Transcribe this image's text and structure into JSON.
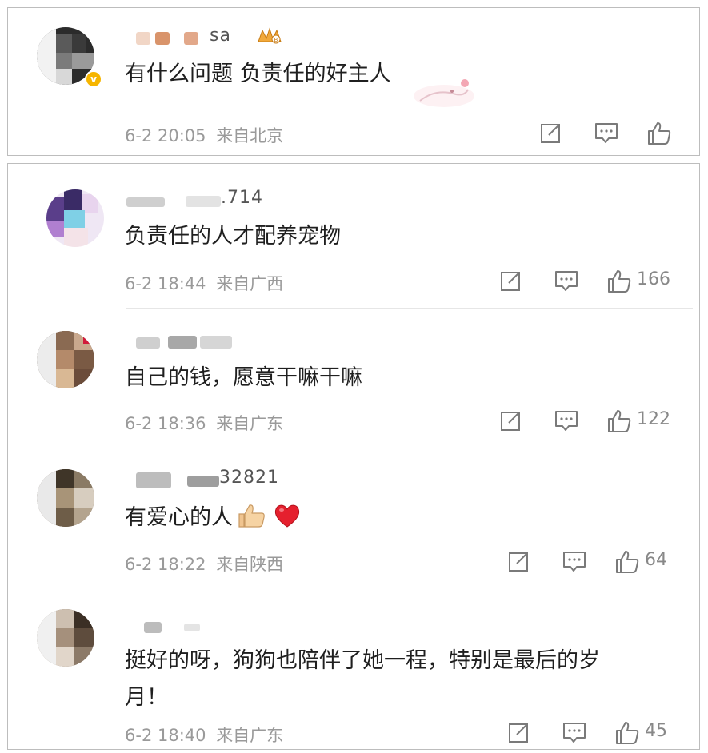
{
  "comments": [
    {
      "username": "sa",
      "verified": true,
      "text": "有什么问题 负责任的好主人",
      "time": "6-2 20:05",
      "location": "来自北京",
      "likes": ""
    },
    {
      "username": ".714",
      "text": "负责任的人才配养宠物",
      "time": "6-2 18:44",
      "location": "来自广西",
      "likes": "166"
    },
    {
      "username": "",
      "text": "自己的钱，愿意干嘛干嘛",
      "time": "6-2 18:36",
      "location": "来自广东",
      "likes": "122"
    },
    {
      "username": "32821",
      "text": "有爱心的人",
      "time": "6-2 18:22",
      "location": "来自陕西",
      "likes": "64"
    },
    {
      "username": "",
      "text_line1": "挺好的呀，狗狗也陪伴了她一程，特别是最后的岁",
      "text_line2": "月！",
      "time": "6-2 18:40",
      "location": "来自广东",
      "likes": "45"
    }
  ],
  "icons": {
    "share": "share-icon",
    "comment": "comment-icon",
    "like": "thumbs-up-icon",
    "verified": "verified-badge-icon",
    "thumbs_emoji": "thumbs-up-emoji",
    "heart_emoji": "red-heart-emoji"
  },
  "colors": {
    "text": "#1f1f1f",
    "meta": "#9a9a9a",
    "icon": "#7a7a7a",
    "verified": "#f6b500",
    "heart": "#e5202e"
  }
}
